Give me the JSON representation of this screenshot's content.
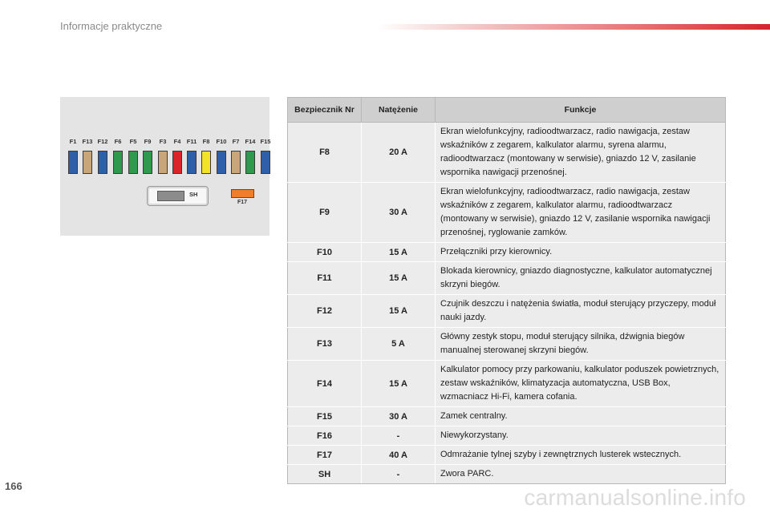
{
  "header": {
    "section_title": "Informacje praktyczne"
  },
  "page_number": "166",
  "watermark": "carmanualsonline.info",
  "diagram": {
    "fuse_labels": [
      "F1",
      "F13",
      "F12",
      "F6",
      "F5",
      "F9",
      "F3",
      "F4",
      "F11",
      "F8",
      "F10",
      "F7",
      "F14",
      "F15"
    ],
    "fuse_colors": [
      "#2f5fa8",
      "#c9a57a",
      "#2f5fa8",
      "#2f9a4e",
      "#2f9a4e",
      "#2f9a4e",
      "#c9a57a",
      "#d9252a",
      "#2f5fa8",
      "#f2e32a",
      "#2f5fa8",
      "#c9a57a",
      "#2f9a4e",
      "#2f5fa8"
    ],
    "sh_label": "SH",
    "f17_label": "F17",
    "f17_color": "#ef7d2a"
  },
  "table": {
    "headers": {
      "fuse_no": "Bezpiecznik Nr",
      "amperage": "Natężenie",
      "functions": "Funkcje"
    },
    "rows": [
      {
        "fuse": "F8",
        "amperage": "20 A",
        "functions": "Ekran wielofunkcyjny, radioodtwarzacz, radio nawigacja, zestaw wskaźników z zegarem, kalkulator alarmu, syrena alarmu, radioodtwarzacz (montowany w serwisie), gniazdo 12 V, zasilanie wspornika nawigacji przenośnej."
      },
      {
        "fuse": "F9",
        "amperage": "30 A",
        "functions": "Ekran wielofunkcyjny, radioodtwarzacz, radio nawigacja, zestaw wskaźników z zegarem, kalkulator alarmu, radioodtwarzacz (montowany w serwisie), gniazdo 12 V, zasilanie wspornika nawigacji przenośnej, ryglowanie zamków."
      },
      {
        "fuse": "F10",
        "amperage": "15 A",
        "functions": "Przełączniki przy kierownicy."
      },
      {
        "fuse": "F11",
        "amperage": "15 A",
        "functions": "Blokada kierownicy, gniazdo diagnostyczne, kalkulator automatycznej skrzyni biegów."
      },
      {
        "fuse": "F12",
        "amperage": "15 A",
        "functions": "Czujnik deszczu i natężenia światła, moduł sterujący przyczepy, moduł nauki jazdy."
      },
      {
        "fuse": "F13",
        "amperage": "5 A",
        "functions": "Główny zestyk stopu, moduł sterujący silnika, dźwignia biegów manualnej sterowanej skrzyni biegów."
      },
      {
        "fuse": "F14",
        "amperage": "15 A",
        "functions": "Kalkulator pomocy przy parkowaniu, kalkulator poduszek powietrznych, zestaw wskaźników, klimatyzacja automatyczna, USB Box, wzmacniacz Hi-Fi, kamera cofania."
      },
      {
        "fuse": "F15",
        "amperage": "30 A",
        "functions": "Zamek centralny."
      },
      {
        "fuse": "F16",
        "amperage": "-",
        "functions": "Niewykorzystany."
      },
      {
        "fuse": "F17",
        "amperage": "40 A",
        "functions": "Odmrażanie tylnej szyby i zewnętrznych lusterek wstecznych."
      },
      {
        "fuse": "SH",
        "amperage": "-",
        "functions": "Zwora PARC."
      }
    ]
  }
}
